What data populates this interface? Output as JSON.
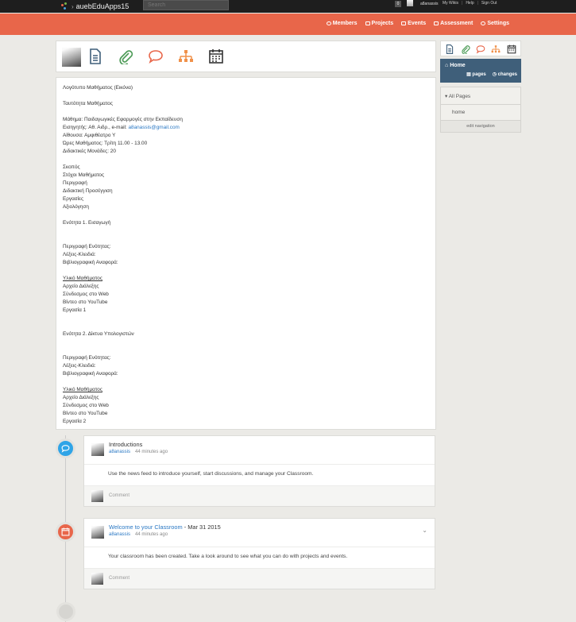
{
  "topbar": {
    "app_name": "auebEduApps15",
    "search_placeholder": "Search",
    "notification_count": "0",
    "username": "a8anassis",
    "links": [
      "My Wikis",
      "Help",
      "Sign Out"
    ]
  },
  "nav": {
    "items": [
      {
        "label": "Members",
        "icon": "members-icon"
      },
      {
        "label": "Projects",
        "icon": "projects-icon"
      },
      {
        "label": "Events",
        "icon": "events-icon"
      },
      {
        "label": "Assessment",
        "icon": "assessment-icon"
      },
      {
        "label": "Settings",
        "icon": "gear-icon"
      }
    ]
  },
  "toolbar": {
    "icons": [
      "page-icon",
      "paperclip-icon",
      "discussion-icon",
      "hierarchy-icon",
      "calendar-icon"
    ],
    "colors": {
      "page": "#3f5f7a",
      "paperclip": "#4d9b57",
      "discussion": "#e8664a",
      "hierarchy": "#f0914a",
      "calendar": "#333333"
    }
  },
  "document": {
    "lines": [
      {
        "text": "Λογότυπο Μαθήματος (Εικόνα)"
      },
      {
        "gap": true
      },
      {
        "text": "Ταυτότητα Μαθήματος"
      },
      {
        "gap": true
      },
      {
        "text": "Μάθημα: Παιδαγωγικές Εφαρμογές στην Εκπαίδευση"
      },
      {
        "text": "Εισηγητής: Αθ. Αιδρ., e-mail: ",
        "link": "a8anassis@gmail.com"
      },
      {
        "text": "Αίθουσα: Αμφιθέατρο Υ"
      },
      {
        "text": "Ώρες Μαθήματος: Τρίτη 11.00 - 13.00"
      },
      {
        "text": "Διδακτικές Μονάδες: 20"
      },
      {
        "gap": true
      },
      {
        "text": "Σκοπός"
      },
      {
        "text": "Στόχοι Μαθήματος"
      },
      {
        "text": "Περιγραφή"
      },
      {
        "text": "Διδακτική Προσέγγιση"
      },
      {
        "text": "Εργασίες"
      },
      {
        "text": "Αξιολόγηση"
      },
      {
        "gap": true
      },
      {
        "text": "Ενότητα 1. Εισαγωγή"
      },
      {
        "gap": true
      },
      {
        "gap": true
      },
      {
        "text": "Περιγραφή Ενότητας:"
      },
      {
        "text": "Λέξεις-Κλειδιά:"
      },
      {
        "text": "Βιβλιογραφική Αναφορά:"
      },
      {
        "gap": true
      },
      {
        "text": "Υλικό Μαθήματος",
        "underline": true
      },
      {
        "text": "Αρχείο Διάλεξης"
      },
      {
        "text": "Σύνδεσμος στο Web"
      },
      {
        "text": "Βίντεο στο YouTube"
      },
      {
        "text": "Εργασία 1"
      },
      {
        "gap": true
      },
      {
        "gap": true
      },
      {
        "text": "Ενότητα 2. Δίκτυα Υπολογιστών"
      },
      {
        "gap": true
      },
      {
        "gap": true
      },
      {
        "text": "Περιγραφή Ενότητας:"
      },
      {
        "text": "Λέξεις-Κλειδιά:"
      },
      {
        "text": "Βιβλιογραφική Αναφορά:"
      },
      {
        "gap": true
      },
      {
        "text": "Υλικό Μαθήματος",
        "underline": true
      },
      {
        "text": "Αρχείο Διάλεξης"
      },
      {
        "text": "Σύνδεσμος στο Web"
      },
      {
        "text": "Βίντεο στο YouTube"
      },
      {
        "text": "Εργασία 2"
      }
    ]
  },
  "sidebar": {
    "home_label": "Home",
    "pages_label": "pages",
    "changes_label": "changes",
    "all_pages_label": "All Pages",
    "page_items": [
      "home"
    ],
    "edit_navigation_label": "edit navigation"
  },
  "feed": [
    {
      "type": "discussion",
      "icon": "speech-bubble-icon",
      "color": "#2fa4e7",
      "title": "Introductions",
      "author": "a8anassis",
      "time": "44 minutes ago",
      "body": "Use the news feed to introduce yourself, start discussions, and manage your Classroom.",
      "comment_placeholder": "Comment"
    },
    {
      "type": "event",
      "icon": "calendar-icon",
      "color": "#e8664a",
      "title": "Welcome to your Classroom",
      "date_suffix": " - Mar 31 2015",
      "author": "a8anassis",
      "time": "44 minutes ago",
      "body": "Your classroom has been created. Take a look around to see what you can do with projects and events.",
      "comment_placeholder": "Comment"
    }
  ]
}
